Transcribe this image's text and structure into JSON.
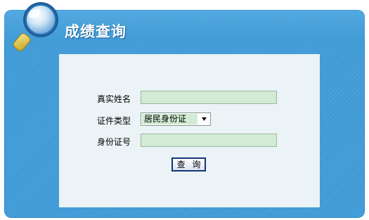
{
  "header": {
    "title": "成绩查询"
  },
  "form": {
    "name_label": "真实姓名",
    "name_value": "",
    "id_type_label": "证件类型",
    "id_type_selected": "居民身份证",
    "id_number_label": "身份证号",
    "id_number_value": "",
    "query_button_label": "查 询"
  },
  "colors": {
    "panel_blue": "#3f9ad6",
    "card_bg": "#ebf3f6",
    "input_green": "#d2ebd4",
    "button_border": "#14347a"
  },
  "icons": {
    "header_icon": "magnifier-icon",
    "select_icon": "chevron-down-icon"
  }
}
